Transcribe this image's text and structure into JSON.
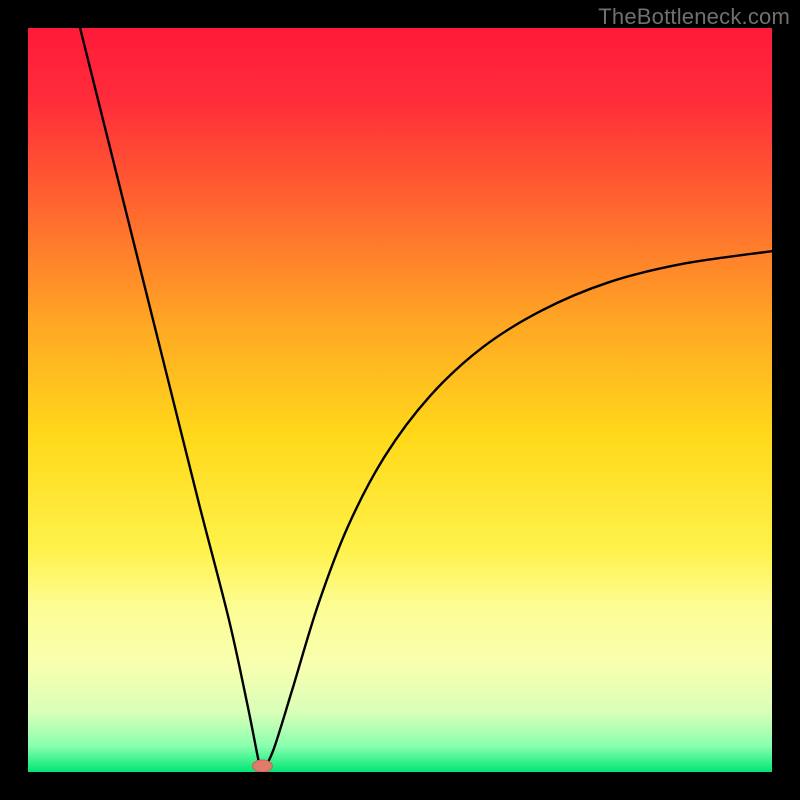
{
  "watermark": "TheBottleneck.com",
  "chart_data": {
    "type": "line",
    "title": "",
    "xlabel": "",
    "ylabel": "",
    "xlim": [
      0,
      1
    ],
    "ylim": [
      0,
      1
    ],
    "gradient_stops": [
      {
        "offset": 0.0,
        "color": "#ff1a3a"
      },
      {
        "offset": 0.1,
        "color": "#ff2d3a"
      },
      {
        "offset": 0.25,
        "color": "#ff6a2e"
      },
      {
        "offset": 0.4,
        "color": "#ffa824"
      },
      {
        "offset": 0.55,
        "color": "#ffd91a"
      },
      {
        "offset": 0.7,
        "color": "#fff24a"
      },
      {
        "offset": 0.78,
        "color": "#fdfd96"
      },
      {
        "offset": 0.86,
        "color": "#f7ffb0"
      },
      {
        "offset": 0.92,
        "color": "#d8ffb8"
      },
      {
        "offset": 0.965,
        "color": "#8affae"
      },
      {
        "offset": 1.0,
        "color": "#00e676"
      }
    ],
    "minimum_point": {
      "x": 0.315,
      "y": 0.0
    },
    "left_branch_start": {
      "x": 0.07,
      "y": 1.0
    },
    "right_branch_end": {
      "x": 1.0,
      "y": 0.7
    },
    "curve_points_left": [
      {
        "x": 0.07,
        "y": 1.0
      },
      {
        "x": 0.11,
        "y": 0.84
      },
      {
        "x": 0.15,
        "y": 0.68
      },
      {
        "x": 0.19,
        "y": 0.52
      },
      {
        "x": 0.23,
        "y": 0.36
      },
      {
        "x": 0.27,
        "y": 0.205
      },
      {
        "x": 0.295,
        "y": 0.09
      },
      {
        "x": 0.31,
        "y": 0.015
      },
      {
        "x": 0.315,
        "y": 0.0
      }
    ],
    "curve_points_right": [
      {
        "x": 0.315,
        "y": 0.0
      },
      {
        "x": 0.33,
        "y": 0.03
      },
      {
        "x": 0.355,
        "y": 0.11
      },
      {
        "x": 0.39,
        "y": 0.225
      },
      {
        "x": 0.43,
        "y": 0.33
      },
      {
        "x": 0.48,
        "y": 0.425
      },
      {
        "x": 0.54,
        "y": 0.505
      },
      {
        "x": 0.61,
        "y": 0.57
      },
      {
        "x": 0.69,
        "y": 0.62
      },
      {
        "x": 0.78,
        "y": 0.658
      },
      {
        "x": 0.88,
        "y": 0.683
      },
      {
        "x": 1.0,
        "y": 0.7
      }
    ],
    "marker": {
      "x": 0.315,
      "y": 0.008,
      "color": "#e07c6c",
      "rx": 10,
      "ry": 6
    }
  }
}
